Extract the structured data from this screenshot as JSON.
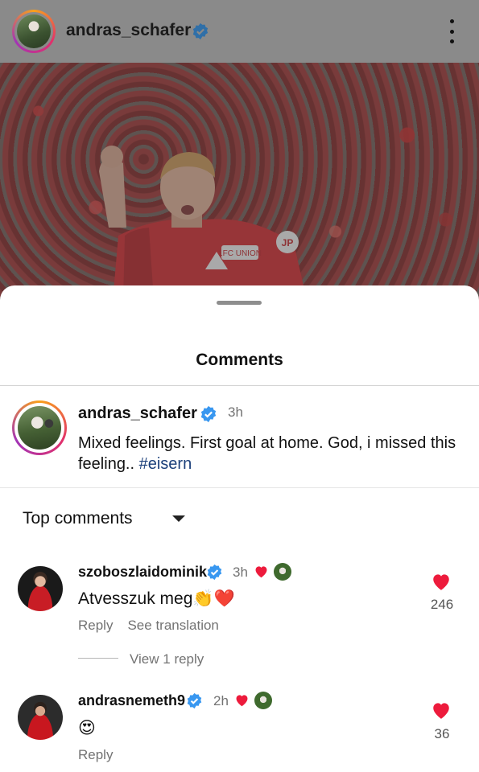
{
  "post": {
    "username": "andras_schafer",
    "verified_icon": "verified-badge-icon",
    "more_icon": "more-options-icon",
    "jersey_sponsor_text": "1FC UNION",
    "jersey_number": "JP"
  },
  "sheet": {
    "title": "Comments"
  },
  "caption": {
    "username": "andras_schafer",
    "time": "3h",
    "text": "Mixed feelings. First goal at home. God, i missed this feeling.. ",
    "hashtag": "#eisern"
  },
  "sort": {
    "label": "Top comments"
  },
  "comments": [
    {
      "username": "szoboszlaidominik",
      "time": "3h",
      "text": "Atvesszuk meg👏❤️",
      "like_count": "246",
      "reply_label": "Reply",
      "translate_label": "See translation",
      "view_replies": "View 1 reply"
    },
    {
      "username": "andrasnemeth9",
      "time": "2h",
      "text": "😍",
      "like_count": "36",
      "reply_label": "Reply"
    }
  ],
  "colors": {
    "verified_blue": "#3897f0",
    "heart_red": "#ed1b3c",
    "hashtag_blue": "#1b3f7a"
  }
}
